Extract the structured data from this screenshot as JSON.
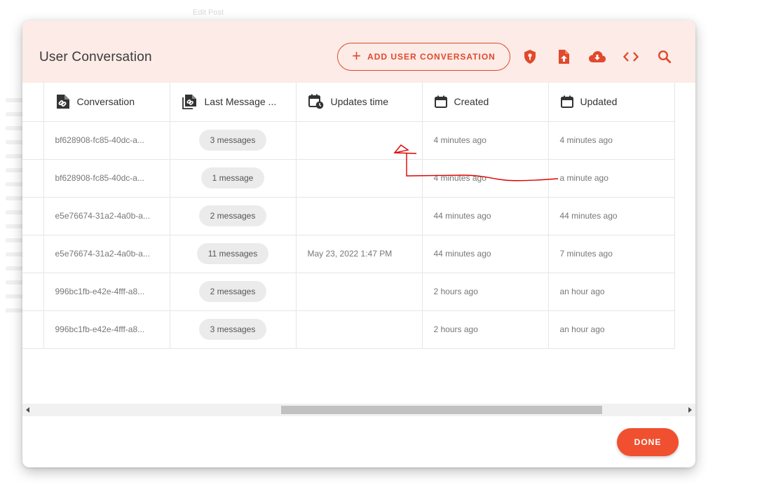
{
  "background": {
    "faint_title": "Edit Post"
  },
  "dialog": {
    "title": "User Conversation",
    "add_button_label": "ADD USER CONVERSATION",
    "done_label": "DONE"
  },
  "colors": {
    "accent": "#f0502f",
    "header_bg": "#fcebe7",
    "annotation": "#e00000"
  },
  "toolbar_icons": [
    "shield-key-icon",
    "file-upload-icon",
    "cloud-download-icon",
    "code-icon",
    "search-icon"
  ],
  "table": {
    "columns": [
      "Conversation",
      "Last Message ...",
      "Updates time",
      "Created",
      "Updated"
    ],
    "rows": [
      {
        "conversation": "bf628908-fc85-40dc-a...",
        "messages": "3 messages",
        "updates_time": "",
        "created": "4 minutes ago",
        "updated": "4 minutes ago"
      },
      {
        "conversation": "bf628908-fc85-40dc-a...",
        "messages": "1 message",
        "updates_time": "",
        "created": "4 minutes ago",
        "updated": "a minute ago"
      },
      {
        "conversation": "e5e76674-31a2-4a0b-a...",
        "messages": "2 messages",
        "updates_time": "",
        "created": "44 minutes ago",
        "updated": "44 minutes ago"
      },
      {
        "conversation": "e5e76674-31a2-4a0b-a...",
        "messages": "11 messages",
        "updates_time": "May 23, 2022 1:47 PM",
        "created": "44 minutes ago",
        "updated": "7 minutes ago"
      },
      {
        "conversation": "996bc1fb-e42e-4fff-a8...",
        "messages": "2 messages",
        "updates_time": "",
        "created": "2 hours ago",
        "updated": "an hour ago"
      },
      {
        "conversation": "996bc1fb-e42e-4fff-a8...",
        "messages": "3 messages",
        "updates_time": "",
        "created": "2 hours ago",
        "updated": "an hour ago"
      }
    ]
  }
}
